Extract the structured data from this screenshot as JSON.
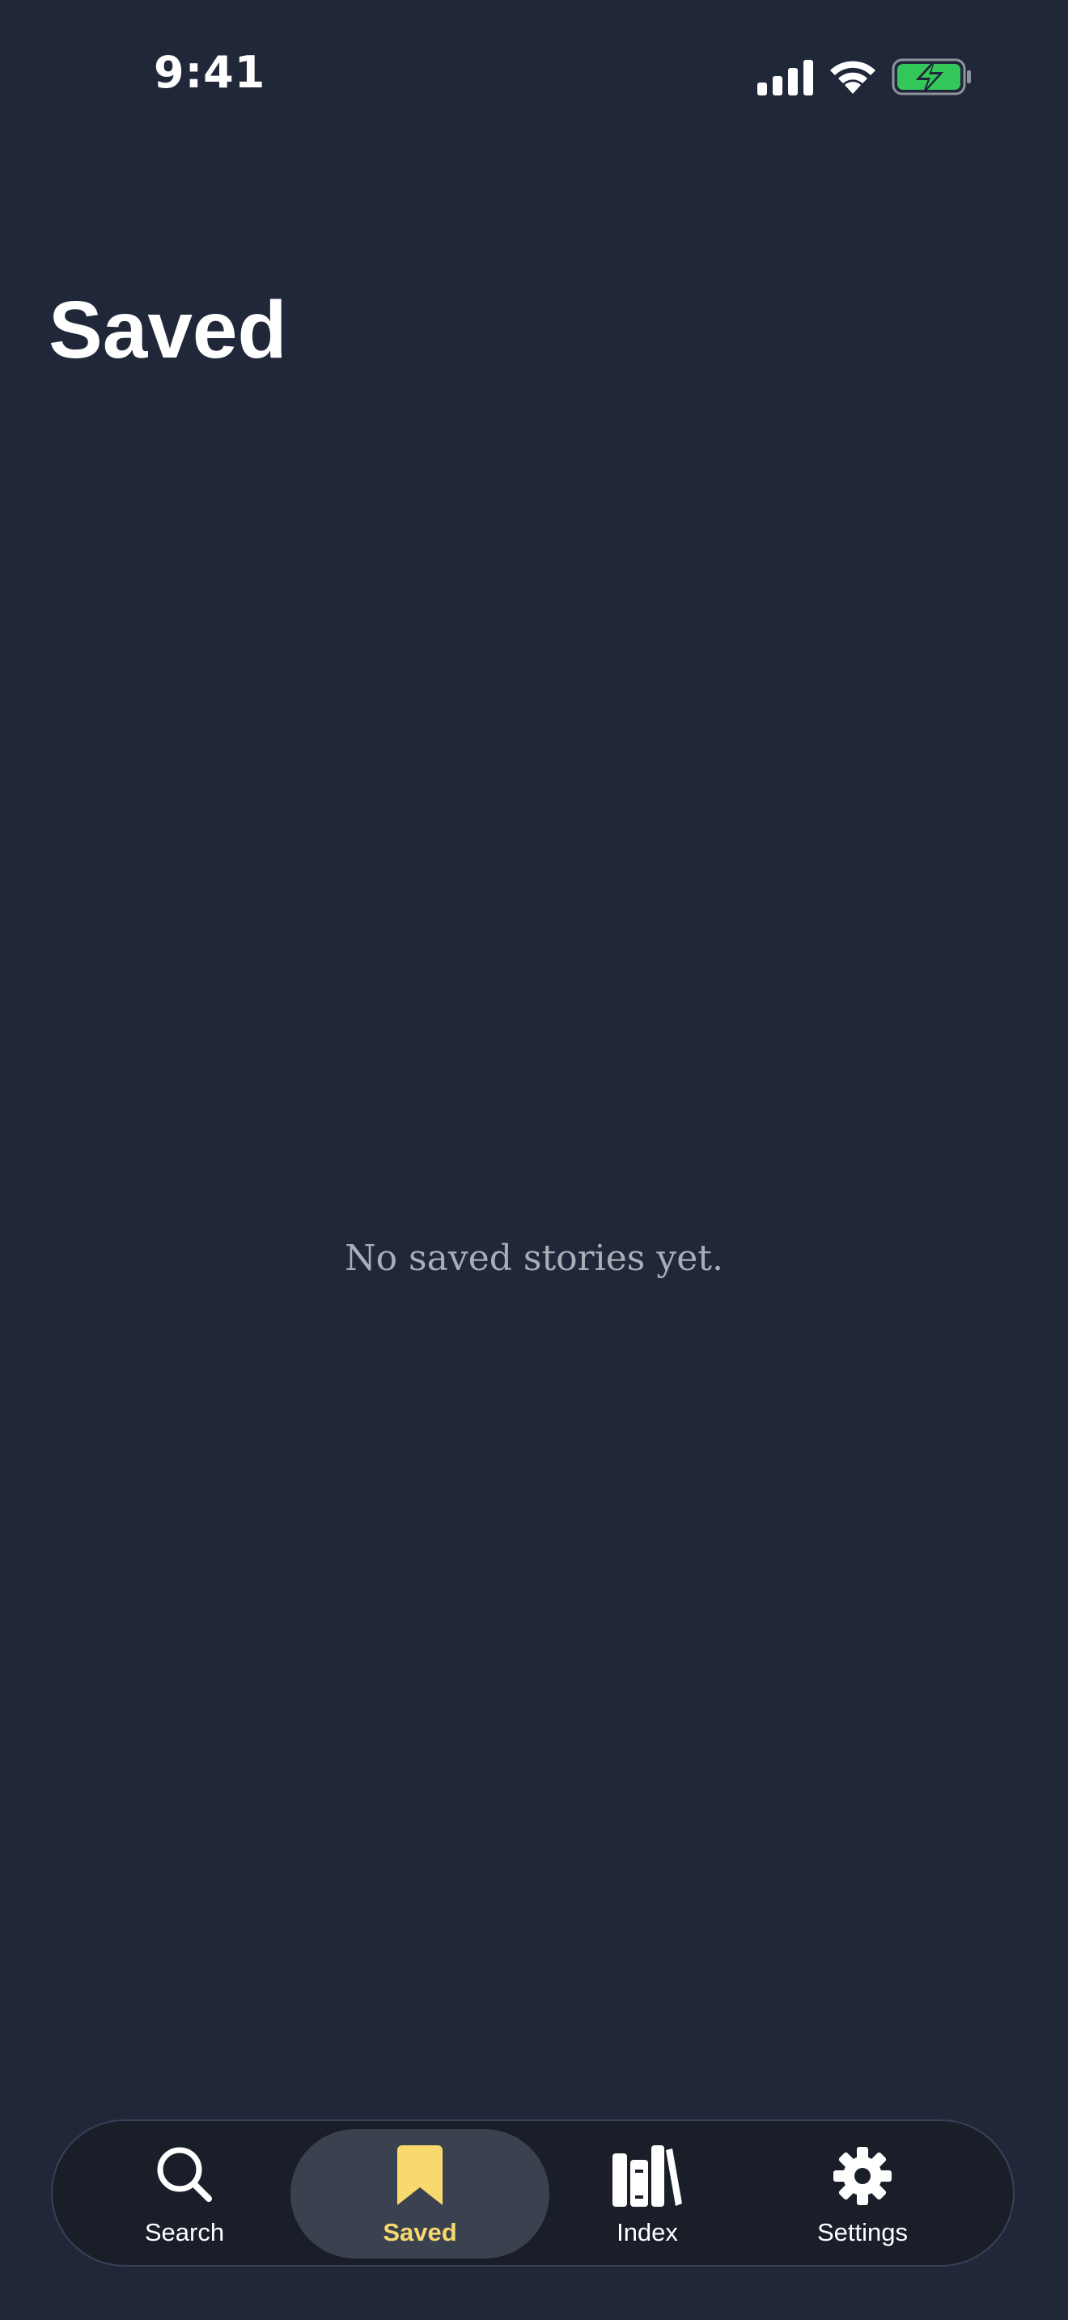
{
  "status_bar": {
    "time": "9:41",
    "icons": [
      "cellular-signal-icon",
      "wifi-icon",
      "battery-charging-icon"
    ],
    "battery_color": "#34c759"
  },
  "page": {
    "title": "Saved",
    "empty_message": "No saved stories yet."
  },
  "tab_bar": {
    "active_tab": "saved",
    "active_color": "#f7d96e",
    "tabs": [
      {
        "id": "search",
        "label": "Search",
        "icon": "magnifying-glass-icon"
      },
      {
        "id": "saved",
        "label": "Saved",
        "icon": "bookmark-icon"
      },
      {
        "id": "index",
        "label": "Index",
        "icon": "books-icon"
      },
      {
        "id": "settings",
        "label": "Settings",
        "icon": "gear-icon"
      }
    ]
  }
}
